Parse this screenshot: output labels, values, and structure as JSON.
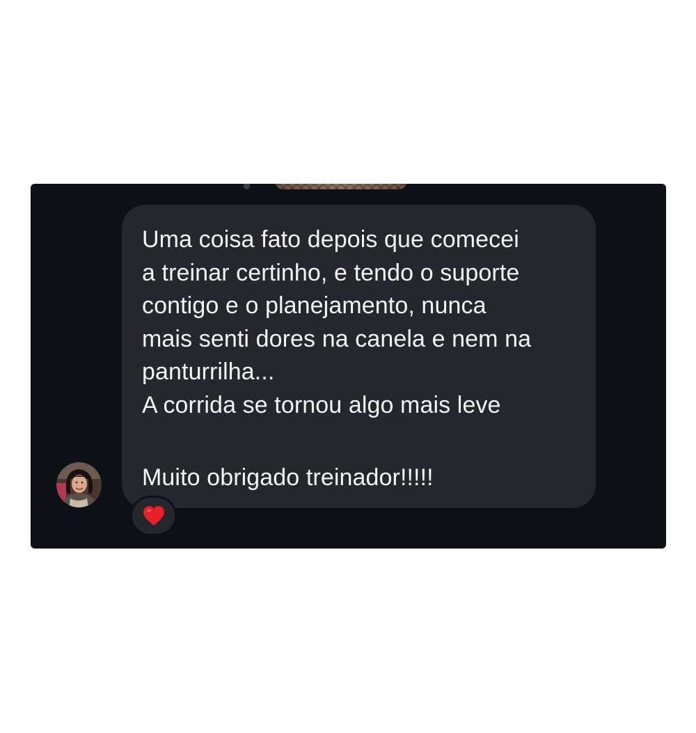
{
  "conversation": {
    "message": {
      "lines": [
        "Uma coisa fato depois que comecei",
        "a treinar certinho, e tendo o suporte",
        "contigo e o planejamento, nunca",
        "mais senti dores na canela e nem na",
        "panturrilha...",
        "A corrida se tornou algo mais leve",
        "",
        "Muito obrigado treinador!!!!!"
      ]
    },
    "reaction": {
      "icon": "red-heart-icon",
      "color": "#e8202a"
    },
    "avatar": {
      "icon": "user-avatar"
    },
    "colors": {
      "background": "#0d1115",
      "bubble": "#25272c",
      "text": "#f3f4f6"
    }
  }
}
